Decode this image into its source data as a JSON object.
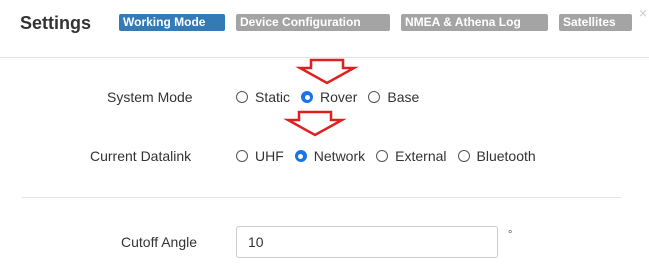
{
  "header": {
    "title": "Settings",
    "tabs": [
      {
        "label": "Working Mode",
        "active": true
      },
      {
        "label": "Device Configuration",
        "active": false
      },
      {
        "label": "NMEA & Athena Log",
        "active": false
      },
      {
        "label": "Satellites",
        "active": false
      }
    ],
    "close_glyph": "×"
  },
  "system_mode": {
    "label": "System Mode",
    "options": [
      {
        "label": "Static",
        "checked": false
      },
      {
        "label": "Rover",
        "checked": true
      },
      {
        "label": "Base",
        "checked": false
      }
    ]
  },
  "current_datalink": {
    "label": "Current Datalink",
    "options": [
      {
        "label": "UHF",
        "checked": false
      },
      {
        "label": "Network",
        "checked": true
      },
      {
        "label": "External",
        "checked": false
      },
      {
        "label": "Bluetooth",
        "checked": false
      }
    ]
  },
  "cutoff_angle": {
    "label": "Cutoff Angle",
    "value": "10",
    "unit": "°"
  },
  "colors": {
    "active_tab": "#337ab7",
    "inactive_tab": "#a4a4a4",
    "radio_checked": "#1a73e8",
    "annotation_arrow": "#e02020"
  },
  "icons": {
    "close": "close-icon",
    "annotation": "arrow-down-icon"
  }
}
